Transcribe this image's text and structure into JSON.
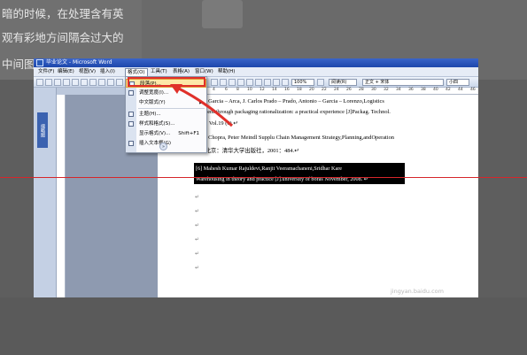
{
  "background": {
    "lines": [
      "暗的时候，在处理含有英",
      "观有彩地方间隔会过大的",
      "中间图"
    ]
  },
  "window": {
    "title": "毕业论文 - Microsoft Word"
  },
  "menubar": {
    "items": [
      "文件(F)",
      "编辑(E)",
      "视图(V)",
      "插入(I)",
      "格式(O)",
      "工具(T)",
      "表格(A)",
      "窗口(W)",
      "帮助(H)"
    ]
  },
  "toolbar": {
    "zoom": "100%",
    "view": "阅读(R)",
    "style": "正文 + 宋体",
    "font_size": "小四"
  },
  "ruler": {
    "numbers": [
      "4",
      "6",
      "8",
      "10",
      "12",
      "14",
      "16",
      "18",
      "20",
      "22",
      "24",
      "26",
      "28",
      "30",
      "32",
      "34",
      "36",
      "38",
      "40",
      "42",
      "44",
      "46"
    ]
  },
  "side_panel": {
    "tab": "缩略图"
  },
  "format_menu": {
    "items": [
      {
        "label": "段落(P)...",
        "shortcut": "",
        "submenu": false,
        "highlighted": true
      },
      {
        "label": "调整宽度(I)...",
        "shortcut": "",
        "submenu": false,
        "highlighted": false
      },
      {
        "label": "中文版式(Y)",
        "shortcut": "",
        "submenu": true,
        "highlighted": false
      },
      {
        "label": "主题(H)...",
        "shortcut": "",
        "submenu": false,
        "highlighted": false
      },
      {
        "label": "样式和格式(S)...",
        "shortcut": "",
        "submenu": false,
        "highlighted": false
      },
      {
        "label": "显示格式(V)...",
        "shortcut": "Shift+F1",
        "submenu": false,
        "highlighted": false
      },
      {
        "label": "插入文本框(G)",
        "shortcut": "",
        "submenu": false,
        "highlighted": false
      }
    ]
  },
  "document": {
    "lines": [
      "Jesus  Garcia – Arca,  J.  Carlos  Prado – Prado,  Antonio – Garcia – Lorenzo,Logistics",
      "ovement  through  packaging  rationalization:  a  practical  experience  [J]Packag.  Technol.",
      "2006, Vol.19 (6).↵",
      "Sunil  Chopra,  Peter  Meindl  Supplu  Chain  Management  Strategy,Planning,andOperation",
      "[M]  北京：清华大学出版社，2001：484.↵"
    ],
    "selected_lines": [
      "[6] Mahesh          Kumar          Rajuldevi,Ranjit          Veeramachaneni,Sridhar Kare",
      "Warehousing in theory and practice [J].university of boras November, 2008.  ↵"
    ],
    "paragraph_mark": "↵"
  },
  "watermark": "jingyan.baidu.com",
  "colors": {
    "highlight_bg": "#fde8a8",
    "annotation_red": "#e0302a",
    "titlebar": "#1d47ac"
  }
}
